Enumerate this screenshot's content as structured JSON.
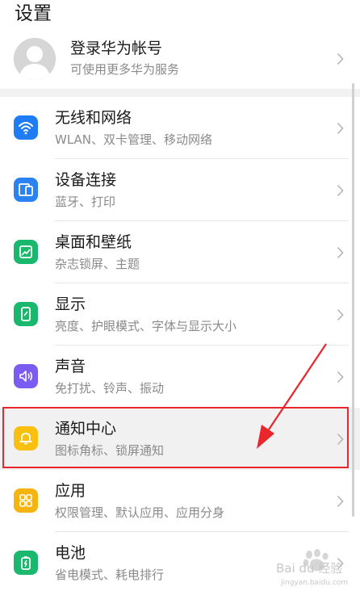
{
  "header": {
    "title": "设置"
  },
  "account": {
    "title": "登录华为帐号",
    "subtitle": "可使用更多华为服务"
  },
  "settings": [
    {
      "label": "无线和网络",
      "sub": "WLAN、双卡管理、移动网络",
      "icon": "wifi-icon",
      "color": "#1f7cf5"
    },
    {
      "label": "设备连接",
      "sub": "蓝牙、打印",
      "icon": "device-connection-icon",
      "color": "#2a83f0"
    },
    {
      "label": "桌面和壁纸",
      "sub": "杂志锁屏、主题",
      "icon": "wallpaper-icon",
      "color": "#19b86d"
    },
    {
      "label": "显示",
      "sub": "亮度、护眼模式、字体与显示大小",
      "icon": "display-icon",
      "color": "#19b86d"
    },
    {
      "label": "声音",
      "sub": "免打扰、铃声、振动",
      "icon": "sound-icon",
      "color": "#7a5cf0"
    },
    {
      "label": "通知中心",
      "sub": "图标角标、锁屏通知",
      "icon": "bell-icon",
      "color": "#fbbf10"
    },
    {
      "label": "应用",
      "sub": "权限管理、默认应用、应用分身",
      "icon": "apps-icon",
      "color": "#f5b50d"
    },
    {
      "label": "电池",
      "sub": "省电模式、耗电排行",
      "icon": "battery-icon",
      "color": "#19b86d"
    }
  ],
  "annotation": {
    "highlight_color": "#e8262b"
  },
  "watermark": {
    "text": "Bai du 经验",
    "url_text": "jingyan.baidu.com"
  }
}
